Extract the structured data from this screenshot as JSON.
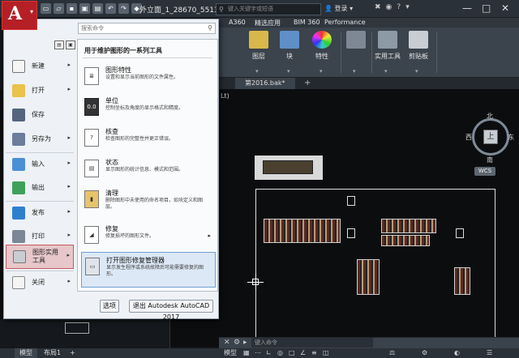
{
  "titlebar": {
    "app_letter": "A",
    "doc_title": "外立面_1_28670_5513...",
    "search_placeholder": "键入关键字或短语",
    "login_label": "登录",
    "window_min": "—",
    "window_max": "□",
    "window_close": "✕"
  },
  "ribbon": {
    "tabs": [
      "A360",
      "精选应用",
      "BIM 360",
      "Performance"
    ],
    "groups": [
      {
        "label": "图层"
      },
      {
        "label": "块"
      },
      {
        "label": "特性"
      },
      {
        "label": "实用工具"
      },
      {
        "label": "剪贴板"
      }
    ]
  },
  "file_tabs": {
    "active": "第2016.bak*"
  },
  "canvas": {
    "view_label": "Lt)"
  },
  "viewcube": {
    "north": "北",
    "south": "南",
    "west": "西",
    "east": "东",
    "face": "上",
    "wcs": "WCS"
  },
  "command_line": {
    "placeholder": "键入命令"
  },
  "statusbar": {
    "model_tab": "模型",
    "layout_tab": "布局1",
    "add_tab": "+",
    "model_btn": "模型"
  },
  "app_menu": {
    "search_placeholder": "搜索命令",
    "items": [
      {
        "label": "新建",
        "has_arrow": true,
        "icon": "new-file-icon",
        "color": "#f2f2f2"
      },
      {
        "label": "打开",
        "has_arrow": true,
        "icon": "open-folder-icon",
        "color": "#e8c24a"
      },
      {
        "label": "保存",
        "has_arrow": false,
        "icon": "save-icon",
        "color": "#5a6c8a"
      },
      {
        "label": "另存为",
        "has_arrow": true,
        "icon": "save-as-icon",
        "color": "#6b7d9b"
      },
      {
        "label": "输入",
        "has_arrow": true,
        "icon": "import-icon",
        "color": "#4c8fd6"
      },
      {
        "label": "输出",
        "has_arrow": true,
        "icon": "export-icon",
        "color": "#3ea05a"
      },
      {
        "label": "发布",
        "has_arrow": true,
        "icon": "publish-icon",
        "color": "#2f7fcf"
      },
      {
        "label": "打印",
        "has_arrow": true,
        "icon": "print-icon",
        "color": "#7b8794"
      },
      {
        "label": "图形实用\n工具",
        "has_arrow": true,
        "icon": "drawing-utilities-icon",
        "color": "#c8cdd3"
      },
      {
        "label": "关闭",
        "has_arrow": true,
        "icon": "close-file-icon",
        "color": "#c73a3a"
      }
    ],
    "submenu": {
      "title": "用于维护图形的一系列工具",
      "items": [
        {
          "title": "图形特性",
          "desc": "设置和显示当前图形的文件属性。",
          "has_arrow": false,
          "icon": "drawing-properties-icon"
        },
        {
          "title": "单位",
          "desc": "控制坐标及角度的显示格式和精度。",
          "has_arrow": false,
          "icon": "units-icon"
        },
        {
          "title": "核查",
          "desc": "检查图形的完整性并更正错误。",
          "has_arrow": false,
          "icon": "audit-icon"
        },
        {
          "title": "状态",
          "desc": "显示图形的统计信息、模式和范围。",
          "has_arrow": false,
          "icon": "status-icon"
        },
        {
          "title": "清理",
          "desc": "删除图形中未使用的命名项目，如块定义和图层。",
          "has_arrow": false,
          "icon": "purge-icon"
        },
        {
          "title": "修复",
          "desc": "修复损坏的图形文件。",
          "has_arrow": true,
          "icon": "recover-icon"
        },
        {
          "title": "打开图形修复管理器",
          "desc": "显示发生程序或系统故障后可能需要修复的图形。",
          "has_arrow": false,
          "icon": "drawing-recovery-manager-icon"
        }
      ]
    },
    "options_button": "选项",
    "exit_button": "退出 Autodesk AutoCAD 2017"
  }
}
